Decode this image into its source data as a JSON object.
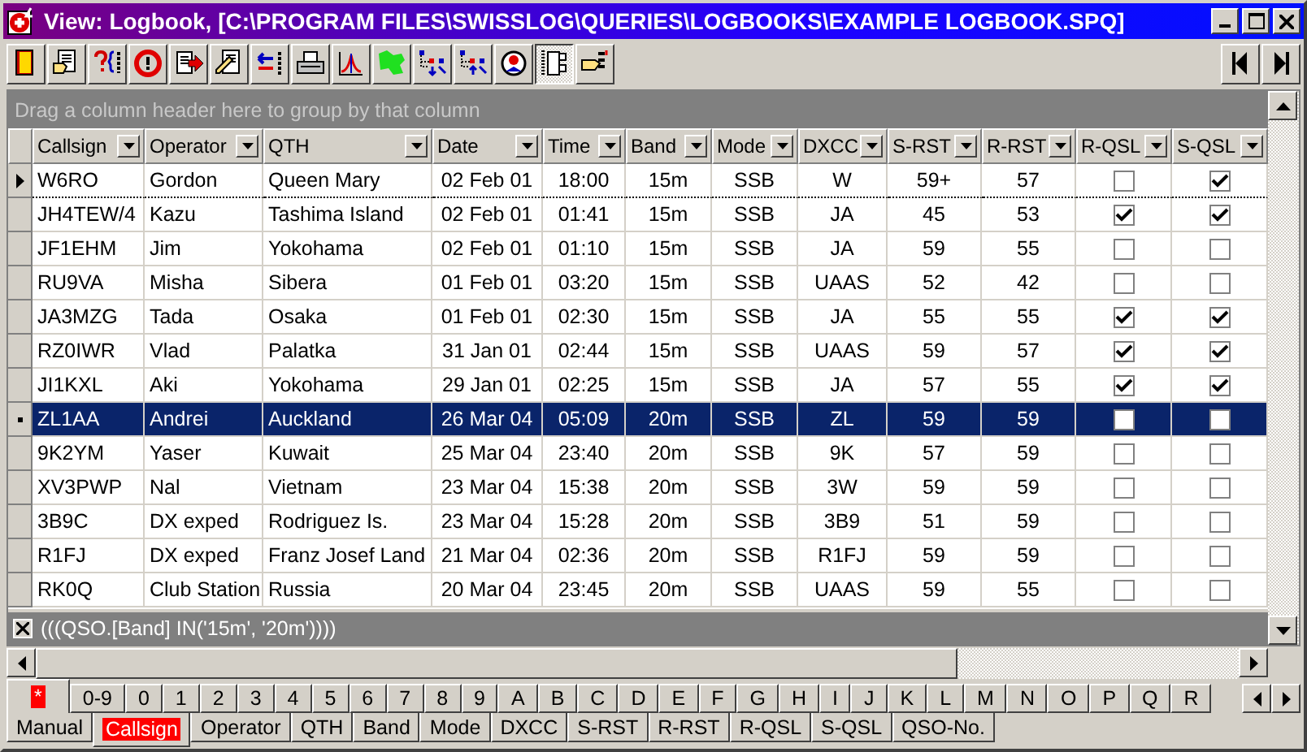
{
  "window": {
    "title": "View: Logbook, [C:\\PROGRAM FILES\\SWISSLOG\\QUERIES\\LOGBOOKS\\EXAMPLE LOGBOOK.SPQ]"
  },
  "toolbar": {
    "buttons": [
      {
        "pressed": false
      },
      {
        "pressed": false
      },
      {
        "pressed": false
      },
      {
        "pressed": false
      },
      {
        "pressed": false
      },
      {
        "pressed": false
      },
      {
        "pressed": false
      },
      {
        "pressed": false
      },
      {
        "pressed": false
      },
      {
        "pressed": false
      },
      {
        "pressed": false
      },
      {
        "pressed": false
      },
      {
        "pressed": false
      },
      {
        "pressed": true
      },
      {
        "pressed": false
      }
    ]
  },
  "group_panel": {
    "hint": "Drag a column header here to group by that column"
  },
  "table": {
    "columns": [
      {
        "label": "Callsign",
        "kind": "text"
      },
      {
        "label": "Operator",
        "kind": "text"
      },
      {
        "label": "QTH",
        "kind": "text"
      },
      {
        "label": "Date",
        "kind": "center"
      },
      {
        "label": "Time",
        "kind": "center"
      },
      {
        "label": "Band",
        "kind": "center"
      },
      {
        "label": "Mode",
        "kind": "center"
      },
      {
        "label": "DXCC",
        "kind": "center"
      },
      {
        "label": "S-RST",
        "kind": "center"
      },
      {
        "label": "R-RST",
        "kind": "center"
      },
      {
        "label": "R-QSL",
        "kind": "check"
      },
      {
        "label": "S-QSL",
        "kind": "check"
      }
    ],
    "rows": [
      {
        "current": true,
        "selected": false,
        "values": [
          "W6RO",
          "Gordon",
          "Queen Mary",
          "02 Feb 01",
          "18:00",
          "15m",
          "SSB",
          "W",
          "59+",
          "57",
          false,
          true
        ]
      },
      {
        "current": false,
        "selected": false,
        "values": [
          "JH4TEW/4",
          "Kazu",
          "Tashima Island",
          "02 Feb 01",
          "01:41",
          "15m",
          "SSB",
          "JA",
          "45",
          "53",
          true,
          true
        ]
      },
      {
        "current": false,
        "selected": false,
        "values": [
          "JF1EHM",
          "Jim",
          "Yokohama",
          "02 Feb 01",
          "01:10",
          "15m",
          "SSB",
          "JA",
          "59",
          "55",
          false,
          false
        ]
      },
      {
        "current": false,
        "selected": false,
        "values": [
          "RU9VA",
          "Misha",
          "Sibera",
          "01 Feb 01",
          "03:20",
          "15m",
          "SSB",
          "UAAS",
          "52",
          "42",
          false,
          false
        ]
      },
      {
        "current": false,
        "selected": false,
        "values": [
          "JA3MZG",
          "Tada",
          "Osaka",
          "01 Feb 01",
          "02:30",
          "15m",
          "SSB",
          "JA",
          "55",
          "55",
          true,
          true
        ]
      },
      {
        "current": false,
        "selected": false,
        "values": [
          "RZ0IWR",
          "Vlad",
          "Palatka",
          "31 Jan 01",
          "02:44",
          "15m",
          "SSB",
          "UAAS",
          "59",
          "57",
          true,
          true
        ]
      },
      {
        "current": false,
        "selected": false,
        "values": [
          "JI1KXL",
          "Aki",
          "Yokohama",
          "29 Jan 01",
          "02:25",
          "15m",
          "SSB",
          "JA",
          "57",
          "55",
          true,
          true
        ]
      },
      {
        "current": false,
        "selected": true,
        "values": [
          "ZL1AA",
          "Andrei",
          "Auckland",
          "26 Mar 04",
          "05:09",
          "20m",
          "SSB",
          "ZL",
          "59",
          "59",
          false,
          false
        ]
      },
      {
        "current": false,
        "selected": false,
        "values": [
          "9K2YM",
          "Yaser",
          "Kuwait",
          "25 Mar 04",
          "23:40",
          "20m",
          "SSB",
          "9K",
          "57",
          "59",
          false,
          false
        ]
      },
      {
        "current": false,
        "selected": false,
        "values": [
          "XV3PWP",
          "Nal",
          "Vietnam",
          "23 Mar 04",
          "15:38",
          "20m",
          "SSB",
          "3W",
          "59",
          "59",
          false,
          false
        ]
      },
      {
        "current": false,
        "selected": false,
        "values": [
          "3B9C",
          "DX exped",
          "Rodriguez Is.",
          "23 Mar 04",
          "15:28",
          "20m",
          "SSB",
          "3B9",
          "51",
          "59",
          false,
          false
        ]
      },
      {
        "current": false,
        "selected": false,
        "values": [
          "R1FJ",
          "DX exped",
          "Franz Josef Land",
          "21 Mar 04",
          "02:36",
          "20m",
          "SSB",
          "R1FJ",
          "59",
          "59",
          false,
          false
        ]
      },
      {
        "current": false,
        "selected": false,
        "values": [
          "RK0Q",
          "Club Station",
          "Russia",
          "20 Mar 04",
          "23:45",
          "20m",
          "SSB",
          "UAAS",
          "59",
          "55",
          false,
          false
        ]
      }
    ]
  },
  "filter": {
    "expression": "(((QSO.[Band] IN('15m', '20m'))))"
  },
  "letter_tabs": [
    {
      "label": "*",
      "selected": true
    },
    {
      "label": "0-9",
      "selected": false
    },
    {
      "label": "0",
      "selected": false
    },
    {
      "label": "1",
      "selected": false
    },
    {
      "label": "2",
      "selected": false
    },
    {
      "label": "3",
      "selected": false
    },
    {
      "label": "4",
      "selected": false
    },
    {
      "label": "5",
      "selected": false
    },
    {
      "label": "6",
      "selected": false
    },
    {
      "label": "7",
      "selected": false
    },
    {
      "label": "8",
      "selected": false
    },
    {
      "label": "9",
      "selected": false
    },
    {
      "label": "A",
      "selected": false
    },
    {
      "label": "B",
      "selected": false
    },
    {
      "label": "C",
      "selected": false
    },
    {
      "label": "D",
      "selected": false
    },
    {
      "label": "E",
      "selected": false
    },
    {
      "label": "F",
      "selected": false
    },
    {
      "label": "G",
      "selected": false
    },
    {
      "label": "H",
      "selected": false
    },
    {
      "label": "I",
      "selected": false
    },
    {
      "label": "J",
      "selected": false
    },
    {
      "label": "K",
      "selected": false
    },
    {
      "label": "L",
      "selected": false
    },
    {
      "label": "M",
      "selected": false
    },
    {
      "label": "N",
      "selected": false
    },
    {
      "label": "O",
      "selected": false
    },
    {
      "label": "P",
      "selected": false
    },
    {
      "label": "Q",
      "selected": false
    },
    {
      "label": "R",
      "selected": false
    }
  ],
  "sort_tabs": [
    {
      "label": "Manual",
      "selected": false
    },
    {
      "label": "Callsign",
      "selected": true
    },
    {
      "label": "Operator",
      "selected": false
    },
    {
      "label": "QTH",
      "selected": false
    },
    {
      "label": "Band",
      "selected": false
    },
    {
      "label": "Mode",
      "selected": false
    },
    {
      "label": "DXCC",
      "selected": false
    },
    {
      "label": "S-RST",
      "selected": false
    },
    {
      "label": "R-RST",
      "selected": false
    },
    {
      "label": "R-QSL",
      "selected": false
    },
    {
      "label": "S-QSL",
      "selected": false
    },
    {
      "label": "QSO-No.",
      "selected": false
    }
  ]
}
